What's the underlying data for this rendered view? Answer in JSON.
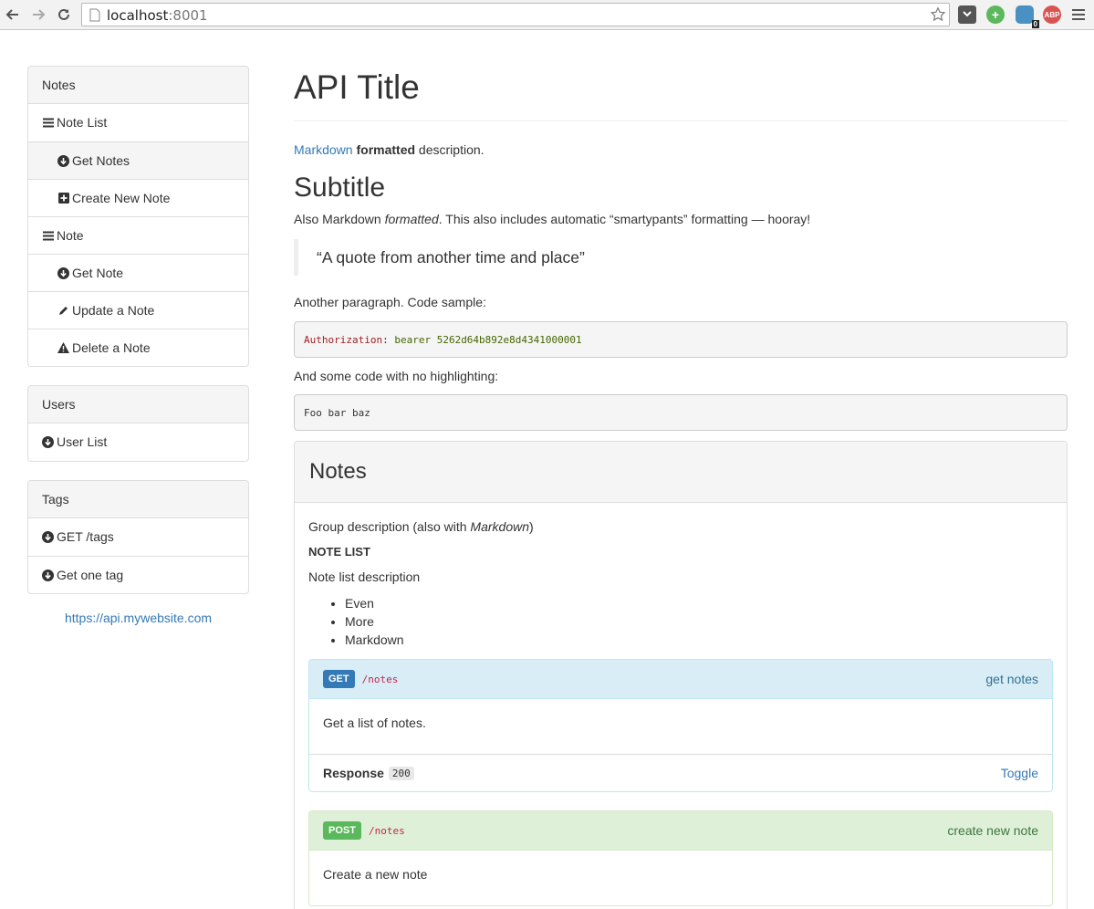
{
  "browser": {
    "url_host": "localhost",
    "url_port": ":8001",
    "extension_badge": "0",
    "abp_label": "ABP"
  },
  "sidebar": {
    "panels": [
      {
        "heading": "Notes",
        "items": [
          {
            "label": "Note List",
            "icon": "menu-icon"
          },
          {
            "label": "Get Notes",
            "icon": "arrow-circle-down-icon"
          },
          {
            "label": "Create New Note",
            "icon": "plus-square-icon"
          },
          {
            "label": "Note",
            "icon": "menu-icon"
          },
          {
            "label": "Get Note",
            "icon": "arrow-circle-down-icon"
          },
          {
            "label": "Update a Note",
            "icon": "pencil-icon"
          },
          {
            "label": "Delete a Note",
            "icon": "warning-icon"
          }
        ]
      },
      {
        "heading": "Users",
        "items": [
          {
            "label": "User List",
            "icon": "arrow-circle-down-icon"
          }
        ]
      },
      {
        "heading": "Tags",
        "items": [
          {
            "label": "GET /tags",
            "icon": "arrow-circle-down-icon"
          },
          {
            "label": "Get one tag",
            "icon": "arrow-circle-down-icon"
          }
        ]
      }
    ],
    "host_link": "https://api.mywebsite.com"
  },
  "main": {
    "title": "API Title",
    "desc_link": "Markdown",
    "desc_bold": "formatted",
    "desc_rest": " description.",
    "subtitle": "Subtitle",
    "subtitle_para_a": "Also Markdown ",
    "subtitle_para_em": "formatted",
    "subtitle_para_b": ". This also includes automatic “smartypants” formatting — hooray!",
    "quote": "“A quote from another time and place”",
    "para2": "Another paragraph. Code sample:",
    "code1_key": "Authorization",
    "code1_colon": ":",
    "code1_value": " bearer 5262d64b892e8d4341000001",
    "para3": "And some code with no highlighting:",
    "code2": "Foo bar baz"
  },
  "group": {
    "title": "Notes",
    "desc_a": "Group description (also with ",
    "desc_em": "Markdown",
    "desc_b": ")",
    "resource_title": "NOTE LIST",
    "resource_desc": "Note list description",
    "bullets": [
      "Even",
      "More",
      "Markdown"
    ],
    "actions": [
      {
        "method": "GET",
        "path": "/notes",
        "name": "get notes",
        "description": "Get a list of notes.",
        "response_label": "Response",
        "response_code": "200",
        "toggle": "Toggle"
      },
      {
        "method": "POST",
        "path": "/notes",
        "name": "create new note",
        "description": "Create a new note"
      }
    ]
  }
}
